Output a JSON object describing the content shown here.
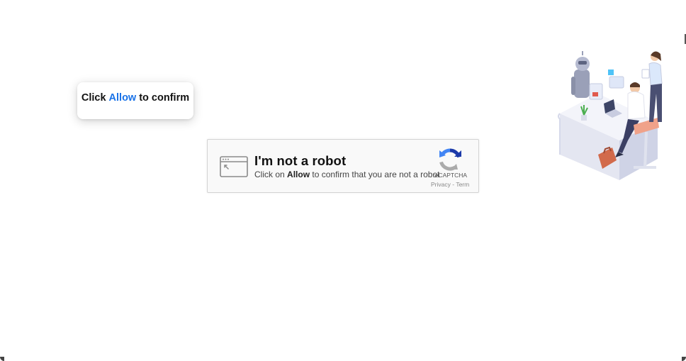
{
  "tooltip": {
    "prefix": "Click",
    "highlight": "Allow",
    "suffix": "to confirm"
  },
  "captcha": {
    "title": "I'm not a robot",
    "sub_prefix": "Click on",
    "sub_bold": "Allow",
    "sub_suffix": "to confirm that you are not a robot",
    "brand": "reCAPTCHA",
    "privacy": "Privacy",
    "separator": "-",
    "terms": "Term"
  },
  "icons": {
    "browser": "browser-window-cursor-icon",
    "recaptcha": "recaptcha-logo-icon"
  },
  "colors": {
    "accent": "#1a73e8",
    "captcha_bg": "#f9f9f9",
    "captcha_border": "#d3d3d3"
  }
}
